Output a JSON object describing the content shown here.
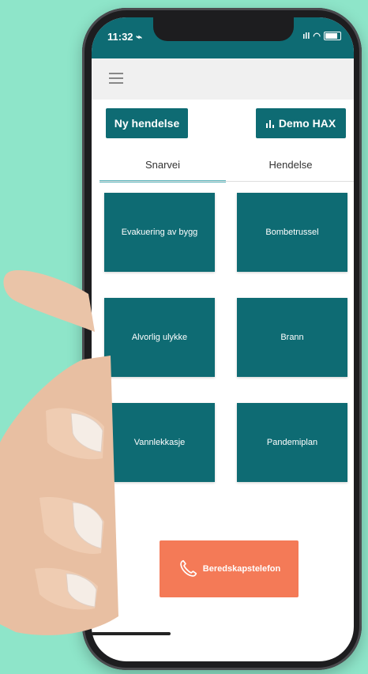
{
  "status_bar": {
    "time": "11:32 ⌁",
    "signal": "ıll",
    "wifi": "◠"
  },
  "header": {
    "menu_icon": "hamburger-icon"
  },
  "buttons": {
    "new_event_label": "Ny hendelse",
    "demo_label": "Demo HAX",
    "demo_icon": "bar-chart-icon"
  },
  "tabs": [
    {
      "label": "Snarvei",
      "active": true
    },
    {
      "label": "Hendelse",
      "active": false
    }
  ],
  "tiles": [
    {
      "label": "Evakuering av bygg"
    },
    {
      "label": "Bombetrussel"
    },
    {
      "label": "Alvorlig ulykke"
    },
    {
      "label": "Brann"
    },
    {
      "label": "Vannlekkasje"
    },
    {
      "label": "Pandemiplan"
    }
  ],
  "call_button": {
    "label": "Beredskapstelefon",
    "icon": "phone-icon"
  },
  "colors": {
    "background": "#8ee5c9",
    "primary": "#0e6b73",
    "accent": "#f47a57",
    "tab_indicator": "#5fb7be"
  }
}
